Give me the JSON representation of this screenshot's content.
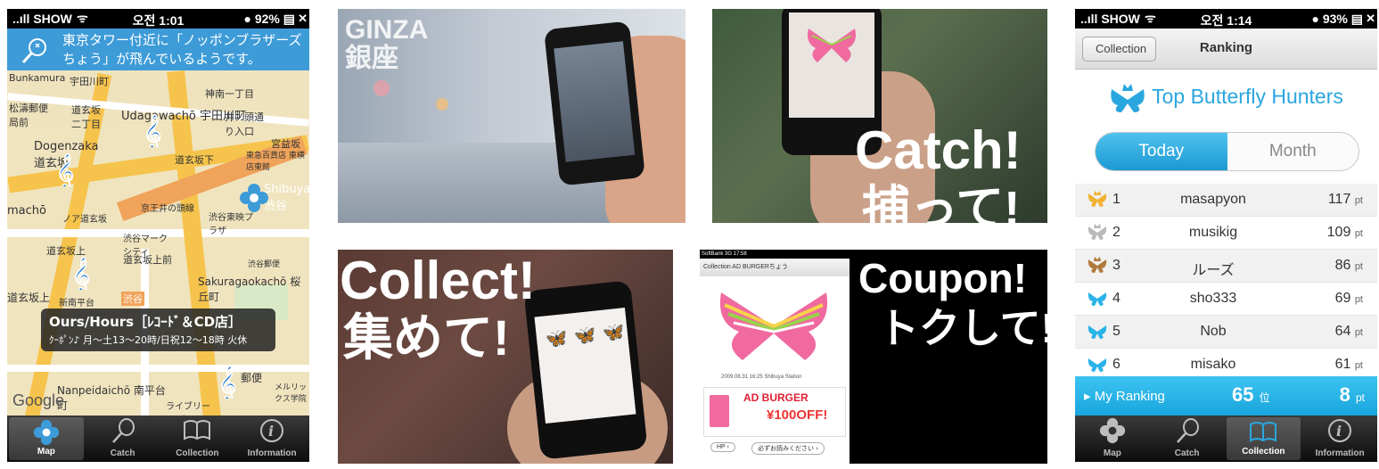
{
  "map_phone": {
    "status": {
      "carrier": "..ıll SHOW",
      "wifi": "ᯤ",
      "time": "오전 1:01",
      "battery": "● 92% ▤",
      "close": "✕"
    },
    "banner": {
      "line1": "東京タワー付近に「ノッポンブラザーズ",
      "line2": "ちょう」が飛んでいるようです。"
    },
    "map_labels": [
      "Bunkamura",
      "宇田川町",
      "神南一丁目",
      "松濤郵便局前",
      "道玄坂二丁目",
      "Udagawachō 宇田川町",
      "井ノ頭通り入口",
      "宮益坂",
      "Dogenzaka 道玄坂",
      "道玄坂下",
      "東急百貨店 東横店東館",
      "Shibuya 渋谷",
      "machō",
      "ノア道玄坂",
      "京王井の頭線",
      "渋谷東映プラザ",
      "渋谷マークシティ",
      "道玄坂上",
      "道玄坂上前",
      "渋谷郵便",
      "Sakuragaokachō 桜丘町",
      "道玄坂上",
      "新南平台",
      "渋谷",
      "Nanpeidaichō 南平台町",
      "ライブリーYSビル",
      "郵便",
      "メルリックス学院"
    ],
    "callout": {
      "title": "Ours/Hours［ﾚｺｰﾄﾞ＆CD店］",
      "detail": "ｸｰﾎﾟﾝ♪ 月〜土13〜20時/日祝12〜18時 火休"
    },
    "google": "Google",
    "tabs": [
      "Map",
      "Catch",
      "Collection",
      "Information"
    ]
  },
  "photos": {
    "ginza": {
      "line1": "GINZA",
      "line2": "銀座"
    },
    "catch": {
      "line1": "Catch!",
      "line2": "捕って!"
    },
    "collect": {
      "line1": "Collect!",
      "line2": "集めて!"
    },
    "coupon": {
      "line1": "Coupon!",
      "line2": "トクして!",
      "screen_status": "SoftBank 3G   17:58",
      "screen_nav": "Collection   AD BURGERちょう",
      "screen_date": "2009.08.31 16:25 Shibuya Station",
      "ad_brand": "AD BURGER",
      "ad_offer": "¥100OFF!",
      "ad_btn1": "HP ›",
      "ad_btn2": "必ずお読みください ›"
    }
  },
  "rank_phone": {
    "status": {
      "carrier": "..ıll SHOW",
      "wifi": "ᯤ",
      "time": "오전 1:14",
      "battery": "● 93% ▤",
      "close": "✕"
    },
    "back": "Collection",
    "title": "Ranking",
    "heading": "Top Butterfly Hunters",
    "segments": [
      "Today",
      "Month"
    ],
    "active_segment": "Today",
    "rows": [
      {
        "rank": "1",
        "name": "masapyon",
        "points": "117",
        "unit": "pt",
        "medal": "#f2b232"
      },
      {
        "rank": "2",
        "name": "musikig",
        "points": "109",
        "unit": "pt",
        "medal": "#b9b9b9"
      },
      {
        "rank": "3",
        "name": "ルーズ",
        "points": "86",
        "unit": "pt",
        "medal": "#b07a3d"
      },
      {
        "rank": "4",
        "name": "sho333",
        "points": "69",
        "unit": "pt",
        "medal": "#29b3e8"
      },
      {
        "rank": "5",
        "name": "Nob",
        "points": "64",
        "unit": "pt",
        "medal": "#29b3e8"
      },
      {
        "rank": "6",
        "name": "misako",
        "points": "61",
        "unit": "pt",
        "medal": "#29b3e8"
      }
    ],
    "my_ranking": {
      "label": "▸ My Ranking",
      "position": "65",
      "position_unit": "位",
      "points": "8",
      "points_unit": "pt"
    },
    "tabs": [
      "Map",
      "Catch",
      "Collection",
      "Information"
    ]
  },
  "colors": {
    "accent_blue": "#2aa6df",
    "banner_blue": "#3d9bd8",
    "butterfly_pink": "#f06aa0"
  }
}
